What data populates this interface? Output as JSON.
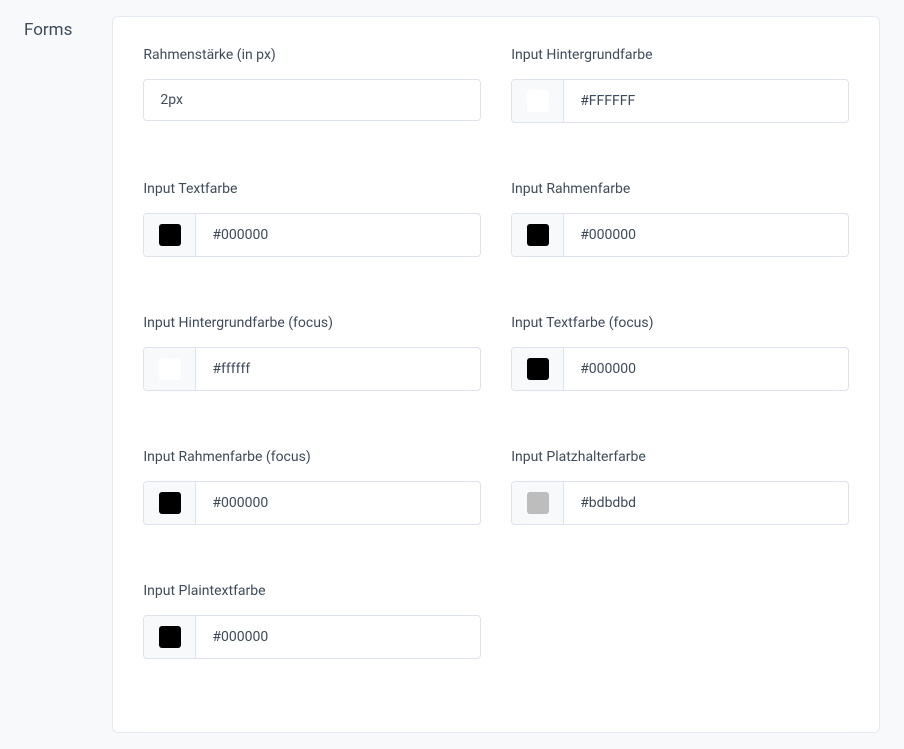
{
  "sidebar": {
    "title": "Forms"
  },
  "fields": {
    "borderWidth": {
      "label": "Rahmenstärke (in px)",
      "value": "2px"
    },
    "bgColor": {
      "label": "Input Hintergrundfarbe",
      "value": "#FFFFFF",
      "swatch": "#FFFFFF"
    },
    "textColor": {
      "label": "Input Textfarbe",
      "value": "#000000",
      "swatch": "#000000"
    },
    "borderColor": {
      "label": "Input Rahmenfarbe",
      "value": "#000000",
      "swatch": "#000000"
    },
    "bgColorFocus": {
      "label": "Input Hintergrundfarbe (focus)",
      "value": "#ffffff",
      "swatch": "#ffffff"
    },
    "textColorFocus": {
      "label": "Input Textfarbe (focus)",
      "value": "#000000",
      "swatch": "#000000"
    },
    "borderColorFocus": {
      "label": "Input Rahmenfarbe (focus)",
      "value": "#000000",
      "swatch": "#000000"
    },
    "placeholderColor": {
      "label": "Input Platzhalterfarbe",
      "value": "#bdbdbd",
      "swatch": "#bdbdbd"
    },
    "plaintextColor": {
      "label": "Input Plaintextfarbe",
      "value": "#000000",
      "swatch": "#000000"
    }
  }
}
